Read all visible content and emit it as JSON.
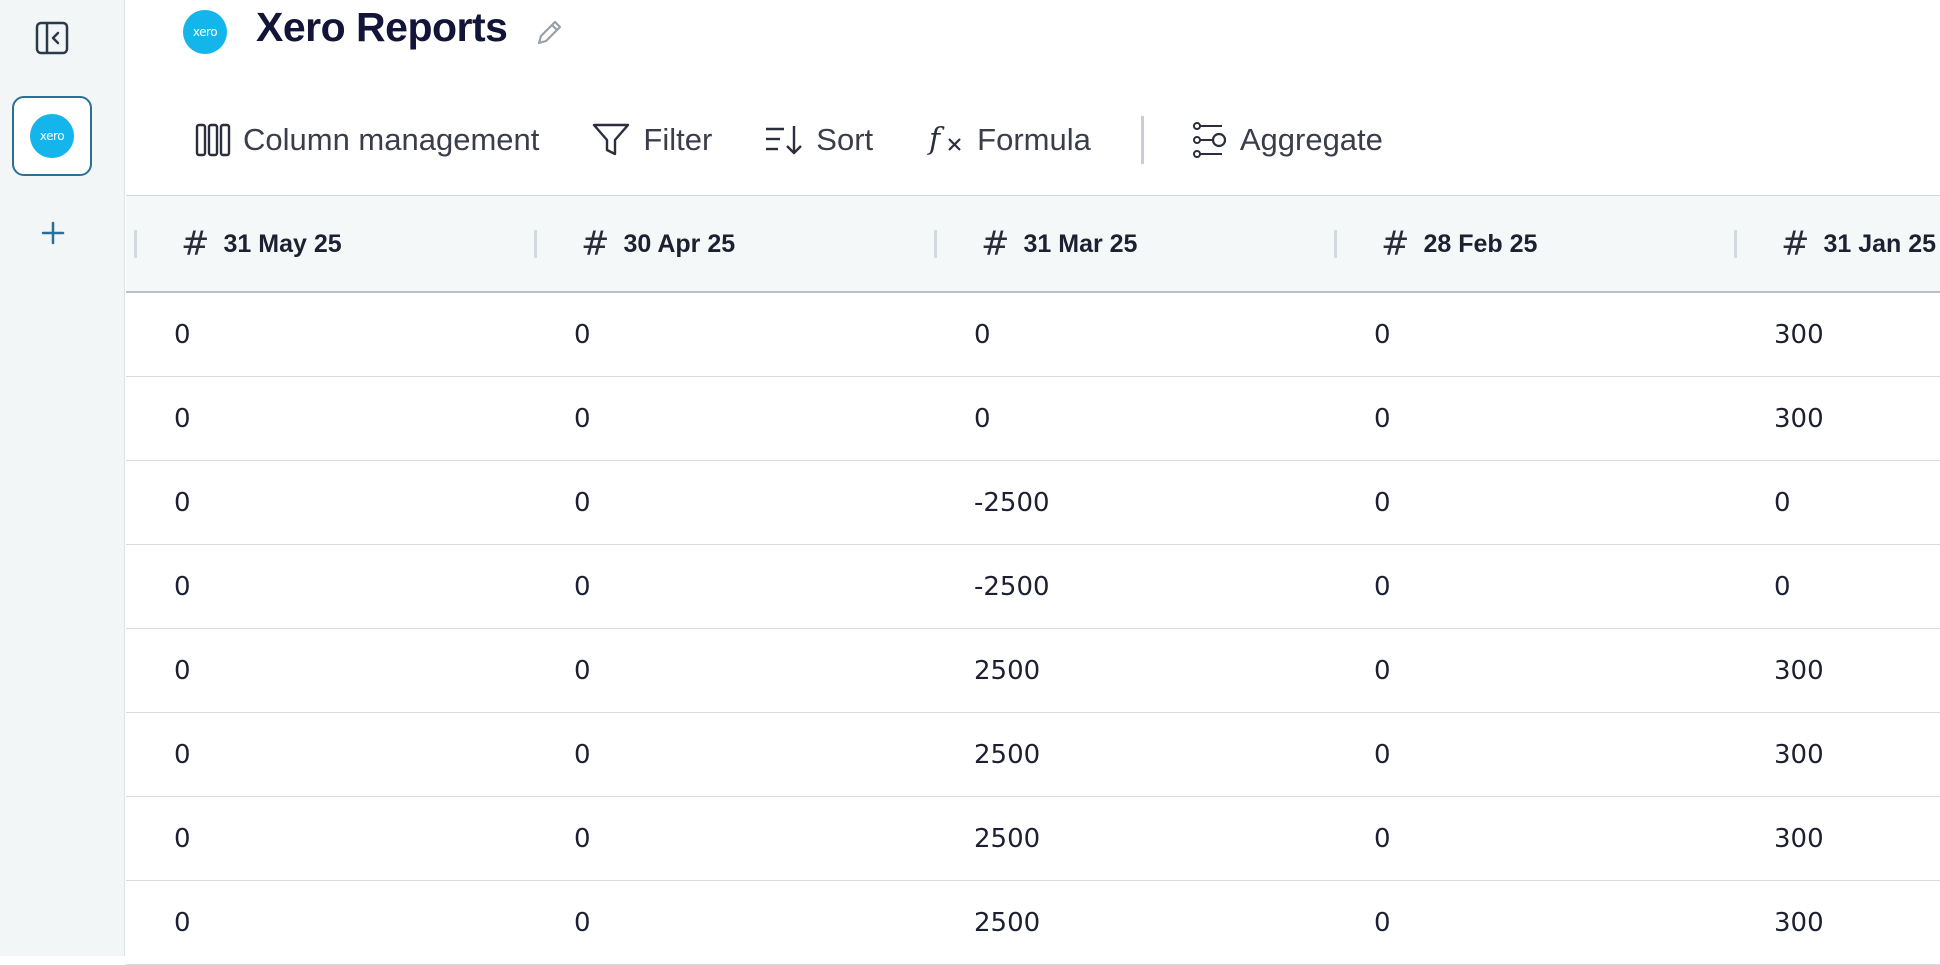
{
  "header": {
    "title": "Xero Reports",
    "logo_text": "xero"
  },
  "rail": {
    "app_logo_text": "xero"
  },
  "toolbar": {
    "column_management": "Column management",
    "filter": "Filter",
    "sort": "Sort",
    "formula": "Formula",
    "aggregate": "Aggregate"
  },
  "table": {
    "columns": [
      "31 May 25",
      "30 Apr 25",
      "31 Mar 25",
      "28 Feb 25",
      "31 Jan 25"
    ],
    "rows": [
      [
        "0",
        "0",
        "0",
        "0",
        "300"
      ],
      [
        "0",
        "0",
        "0",
        "0",
        "300"
      ],
      [
        "0",
        "0",
        "-2500",
        "0",
        "0"
      ],
      [
        "0",
        "0",
        "-2500",
        "0",
        "0"
      ],
      [
        "0",
        "0",
        "2500",
        "0",
        "300"
      ],
      [
        "0",
        "0",
        "2500",
        "0",
        "300"
      ],
      [
        "0",
        "0",
        "2500",
        "0",
        "300"
      ],
      [
        "0",
        "0",
        "2500",
        "0",
        "300"
      ]
    ]
  }
}
